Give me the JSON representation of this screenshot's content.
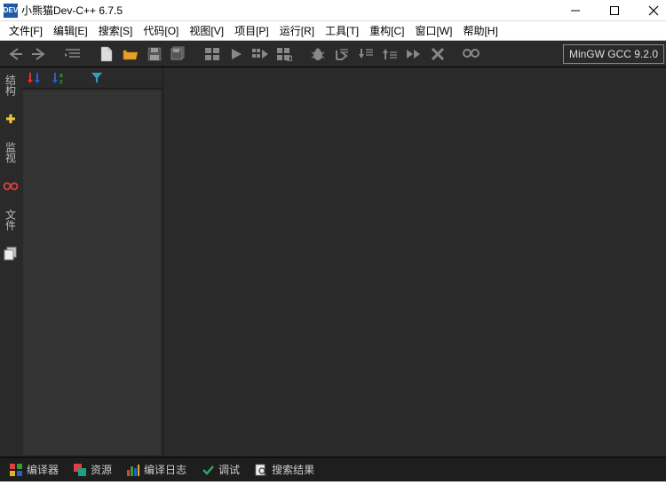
{
  "title": "小熊猫Dev-C++ 6.7.5",
  "app_icon_text": "DEV",
  "menu": {
    "file": "文件[F]",
    "edit": "编辑[E]",
    "search": "搜索[S]",
    "code": "代码[O]",
    "view": "视图[V]",
    "project": "项目[P]",
    "run": "运行[R]",
    "tools": "工具[T]",
    "refactor": "重构[C]",
    "window": "窗口[W]",
    "help": "帮助[H]"
  },
  "toolbar": {
    "compiler_label": "MinGW GCC 9.2.0"
  },
  "leftbar": {
    "structure": "结构",
    "watch": "监视",
    "files": "文件"
  },
  "bottom": {
    "compiler": "编译器",
    "resources": "资源",
    "compile_log": "编译日志",
    "debug": "调试",
    "search_results": "搜索结果"
  }
}
